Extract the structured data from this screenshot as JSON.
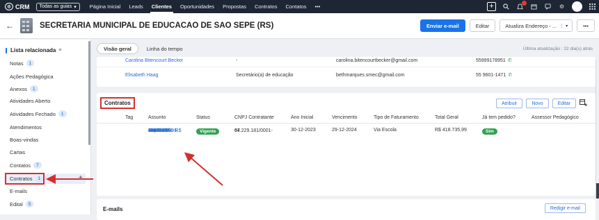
{
  "topbar": {
    "brand": "CRM",
    "guides_label": "Todas as guias",
    "nav": [
      "Página Inicial",
      "Leads",
      "Clientes",
      "Oportunidades",
      "Propostas",
      "Contratos",
      "Contatos",
      "•••"
    ],
    "active_nav_index": 2,
    "icons": [
      "plus-icon",
      "search-icon",
      "bell-icon",
      "calendar-icon",
      "chat-icon",
      "gear-icon",
      "avatar",
      "apps-grid-icon"
    ]
  },
  "record": {
    "title": "SECRETARIA MUNICIPAL DE EDUCACAO DE SAO SEPE (RS)",
    "send_email": "Enviar e-mail",
    "edit": "Editar",
    "update_address": "Atualiza Endereço - ...",
    "more": "•••"
  },
  "sidebar": {
    "heading": "Lista relacionada",
    "items": [
      {
        "label": "Notas",
        "count": "1"
      },
      {
        "label": "Ações Pedagógica",
        "count": ""
      },
      {
        "label": "Anexos",
        "count": "1"
      },
      {
        "label": "Atividades Aberto",
        "count": ""
      },
      {
        "label": "Atividades Fechado",
        "count": "1"
      },
      {
        "label": "Atendimentos",
        "count": ""
      },
      {
        "label": "Boas-vindas",
        "count": ""
      },
      {
        "label": "Cartas",
        "count": ""
      },
      {
        "label": "Contatos",
        "count": "7"
      },
      {
        "label": "Contratos",
        "count": "1"
      },
      {
        "label": "E-mails",
        "count": ""
      },
      {
        "label": "Edital",
        "count": "5"
      }
    ],
    "selected_index": 9
  },
  "tabs": {
    "overview": "Visão geral",
    "timeline": "Linha do tempo",
    "last_update": "Última atualização : 22 dia(s) atrás"
  },
  "contacts": [
    {
      "name": "Carolina Bitencourt Becker",
      "role": "-",
      "email": "carolina.bitencourtbecker@gmail.com",
      "phone": "55999178951"
    },
    {
      "name": "Elisabeth Haag",
      "role": "Secretário(a) de educação",
      "email": "bethmarques.smec@gmail.com",
      "phone": "55 9601-1471"
    }
  ],
  "contracts": {
    "title": "Contratos",
    "buttons": {
      "attach": "Atribuir",
      "new": "Novo",
      "edit": "Editar"
    },
    "columns": [
      "Tag",
      "Assunto",
      "Status",
      "CNPJ Contratante",
      "Ano Inicial",
      "Vencimento",
      "Tipo de Faturamento",
      "Total Geral",
      "Já tem pedido?",
      "Assessor Pedagógico"
    ],
    "rows": [
      {
        "tag": "",
        "subject": [
          "Contrato",
          "2024 -",
          "SISTEMA DE",
          "ENSINO -",
          "MAXI - São",
          "Sepé - RS - R$",
          "418735.99"
        ],
        "status": "Vigente",
        "cnpj": [
          "97.229.181/0001-",
          "64"
        ],
        "start": "30-12-2023",
        "due": "29-12-2024",
        "billing": "Via Escola",
        "total": "R$ 418.735,99",
        "has_order": "Sim",
        "advisor": ""
      }
    ]
  },
  "emails": {
    "title": "E-mails",
    "compose": "Redigir e-mail"
  },
  "colors": {
    "nav_bg": "#1e2633",
    "primary": "#1a73e8",
    "link": "#2b6cd6",
    "status_green": "#2ea44f",
    "highlight_red": "#d32f2f"
  }
}
